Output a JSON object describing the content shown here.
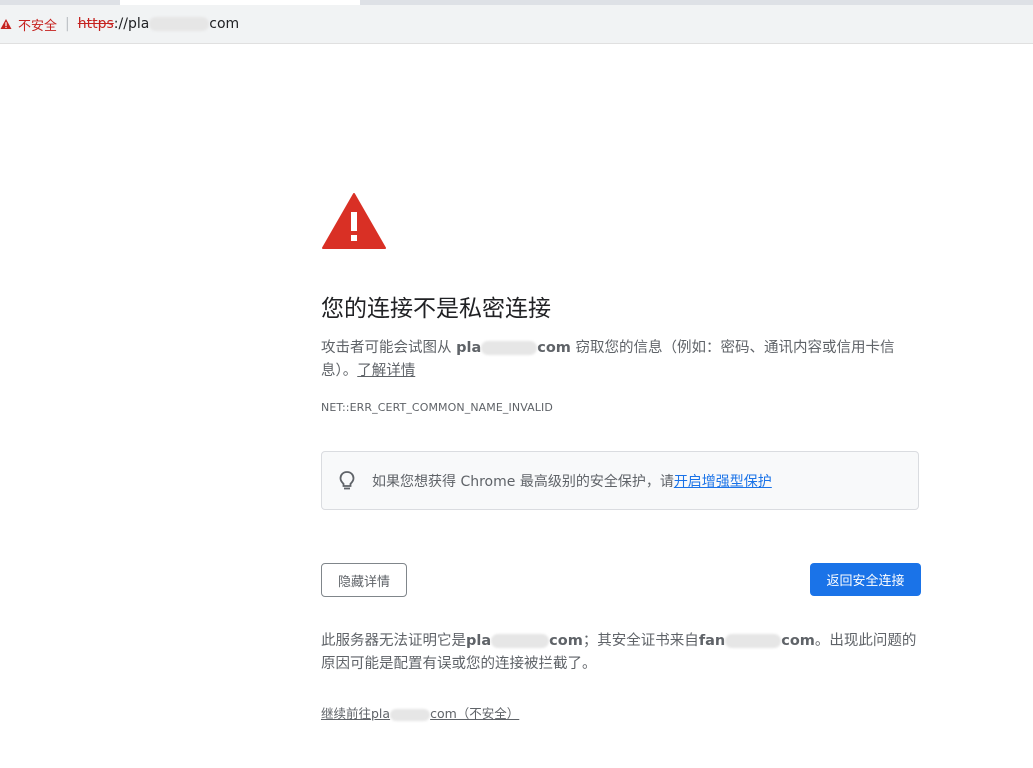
{
  "browser": {
    "security_label": "不安全",
    "separator": "|",
    "url_scheme": "https",
    "url_sep": "://",
    "url_host_start": "pla",
    "url_host_end": "com"
  },
  "interstitial": {
    "heading": "您的连接不是私密连接",
    "desc_before": "攻击者可能会试图从 ",
    "desc_host_start": "pla",
    "desc_host_end": "com",
    "desc_after": " 窃取您的信息（例如：密码、通讯内容或信用卡信息）。",
    "learn_more": "了解详情",
    "error_code": "NET::ERR_CERT_COMMON_NAME_INVALID",
    "enhanced_text": "如果您想获得 Chrome 最高级别的安全保护，请",
    "enhanced_link": "开启增强型保护",
    "hide_details_button": "隐藏详情",
    "back_button": "返回安全连接",
    "details_part1": "此服务器无法证明它是",
    "details_host1_start": "pla",
    "details_host1_end": "com",
    "details_part2": "；其安全证书来自",
    "details_host2_start": "fan",
    "details_host2_end": "com",
    "details_part3": "。出现此问题的原因可能是配置有误或您的连接被拦截了。",
    "proceed_start": "继续前往pla",
    "proceed_end": "com（不安全）"
  },
  "colors": {
    "warning_red": "#d93025",
    "primary_blue": "#1a73e8",
    "text_grey": "#5f6368"
  },
  "icons": [
    "warning-icon",
    "lightbulb-icon"
  ]
}
